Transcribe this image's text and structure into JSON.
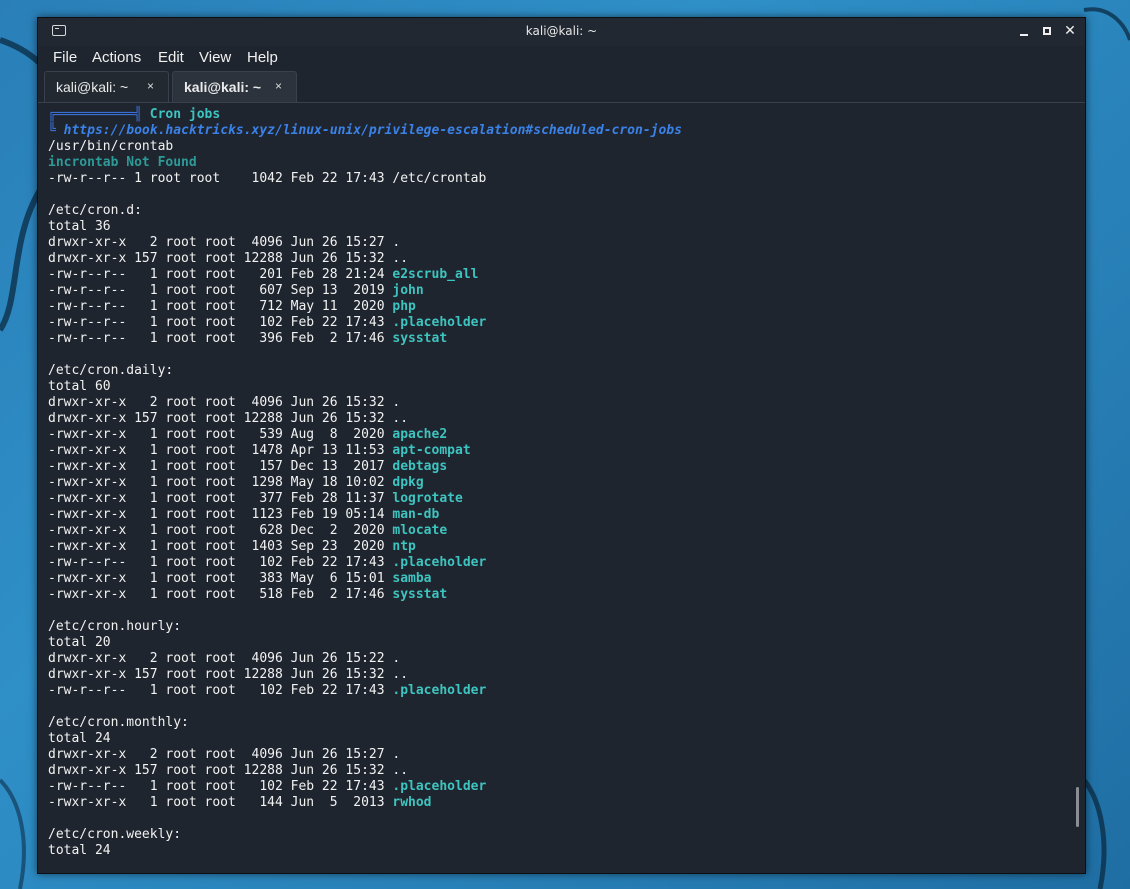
{
  "window": {
    "title": "kali@kali: ~",
    "controls": {
      "minimize": "minimize-icon",
      "maximize": "maximize-icon",
      "close": "✕"
    }
  },
  "menu": [
    "File",
    "Actions",
    "Edit",
    "View",
    "Help"
  ],
  "tabs": [
    {
      "label": "kali@kali: ~",
      "close": "×",
      "active": false
    },
    {
      "label": "kali@kali: ~",
      "close": "×",
      "active": true
    }
  ],
  "terminal": {
    "header_box_top": "╔══════════╣",
    "header_title": " Cron jobs",
    "header_box_side": "╚ ",
    "header_link": "https://book.hacktricks.xyz/linux-unix/privilege-escalation#scheduled-cron-jobs",
    "lines": [
      [
        {
          "t": "/usr/bin/crontab"
        }
      ],
      [
        {
          "t": "incrontab Not Found",
          "c": "c-teal"
        }
      ],
      [
        {
          "t": "-rw-r--r-- 1 root root    1042 Feb 22 17:43 /etc/crontab"
        }
      ],
      [
        {
          "t": ""
        }
      ],
      [
        {
          "t": "/etc/cron.d:"
        }
      ],
      [
        {
          "t": "total 36"
        }
      ],
      [
        {
          "t": "drwxr-xr-x   2 root root  4096 Jun 26 15:27 ."
        }
      ],
      [
        {
          "t": "drwxr-xr-x 157 root root 12288 Jun 26 15:32 .."
        }
      ],
      [
        {
          "t": "-rw-r--r--   1 root root   201 Feb 28 21:24 "
        },
        {
          "t": "e2scrub_all",
          "c": "c-file"
        }
      ],
      [
        {
          "t": "-rw-r--r--   1 root root   607 Sep 13  2019 "
        },
        {
          "t": "john",
          "c": "c-file"
        }
      ],
      [
        {
          "t": "-rw-r--r--   1 root root   712 May 11  2020 "
        },
        {
          "t": "php",
          "c": "c-file"
        }
      ],
      [
        {
          "t": "-rw-r--r--   1 root root   102 Feb 22 17:43 "
        },
        {
          "t": ".placeholder",
          "c": "c-file"
        }
      ],
      [
        {
          "t": "-rw-r--r--   1 root root   396 Feb  2 17:46 "
        },
        {
          "t": "sysstat",
          "c": "c-file"
        }
      ],
      [
        {
          "t": ""
        }
      ],
      [
        {
          "t": "/etc/cron.daily:"
        }
      ],
      [
        {
          "t": "total 60"
        }
      ],
      [
        {
          "t": "drwxr-xr-x   2 root root  4096 Jun 26 15:32 ."
        }
      ],
      [
        {
          "t": "drwxr-xr-x 157 root root 12288 Jun 26 15:32 .."
        }
      ],
      [
        {
          "t": "-rwxr-xr-x   1 root root   539 Aug  8  2020 "
        },
        {
          "t": "apache2",
          "c": "c-file"
        }
      ],
      [
        {
          "t": "-rwxr-xr-x   1 root root  1478 Apr 13 11:53 "
        },
        {
          "t": "apt-compat",
          "c": "c-file"
        }
      ],
      [
        {
          "t": "-rwxr-xr-x   1 root root   157 Dec 13  2017 "
        },
        {
          "t": "debtags",
          "c": "c-file"
        }
      ],
      [
        {
          "t": "-rwxr-xr-x   1 root root  1298 May 18 10:02 "
        },
        {
          "t": "dpkg",
          "c": "c-file"
        }
      ],
      [
        {
          "t": "-rwxr-xr-x   1 root root   377 Feb 28 11:37 "
        },
        {
          "t": "logrotate",
          "c": "c-file"
        }
      ],
      [
        {
          "t": "-rwxr-xr-x   1 root root  1123 Feb 19 05:14 "
        },
        {
          "t": "man-db",
          "c": "c-file"
        }
      ],
      [
        {
          "t": "-rwxr-xr-x   1 root root   628 Dec  2  2020 "
        },
        {
          "t": "mlocate",
          "c": "c-file"
        }
      ],
      [
        {
          "t": "-rwxr-xr-x   1 root root  1403 Sep 23  2020 "
        },
        {
          "t": "ntp",
          "c": "c-file"
        }
      ],
      [
        {
          "t": "-rw-r--r--   1 root root   102 Feb 22 17:43 "
        },
        {
          "t": ".placeholder",
          "c": "c-file"
        }
      ],
      [
        {
          "t": "-rwxr-xr-x   1 root root   383 May  6 15:01 "
        },
        {
          "t": "samba",
          "c": "c-file"
        }
      ],
      [
        {
          "t": "-rwxr-xr-x   1 root root   518 Feb  2 17:46 "
        },
        {
          "t": "sysstat",
          "c": "c-file"
        }
      ],
      [
        {
          "t": ""
        }
      ],
      [
        {
          "t": "/etc/cron.hourly:"
        }
      ],
      [
        {
          "t": "total 20"
        }
      ],
      [
        {
          "t": "drwxr-xr-x   2 root root  4096 Jun 26 15:22 ."
        }
      ],
      [
        {
          "t": "drwxr-xr-x 157 root root 12288 Jun 26 15:32 .."
        }
      ],
      [
        {
          "t": "-rw-r--r--   1 root root   102 Feb 22 17:43 "
        },
        {
          "t": ".placeholder",
          "c": "c-file"
        }
      ],
      [
        {
          "t": ""
        }
      ],
      [
        {
          "t": "/etc/cron.monthly:"
        }
      ],
      [
        {
          "t": "total 24"
        }
      ],
      [
        {
          "t": "drwxr-xr-x   2 root root  4096 Jun 26 15:27 ."
        }
      ],
      [
        {
          "t": "drwxr-xr-x 157 root root 12288 Jun 26 15:32 .."
        }
      ],
      [
        {
          "t": "-rw-r--r--   1 root root   102 Feb 22 17:43 "
        },
        {
          "t": ".placeholder",
          "c": "c-file"
        }
      ],
      [
        {
          "t": "-rwxr-xr-x   1 root root   144 Jun  5  2013 "
        },
        {
          "t": "rwhod",
          "c": "c-file"
        }
      ],
      [
        {
          "t": ""
        }
      ],
      [
        {
          "t": "/etc/cron.weekly:"
        }
      ],
      [
        {
          "t": "total 24"
        }
      ]
    ]
  },
  "colors": {
    "desktop": "#2a7fb8",
    "terminal_bg": "#1f252e",
    "text": "#f2f2f2",
    "highlight": "#3ec4c0",
    "link": "#3b82e8"
  }
}
